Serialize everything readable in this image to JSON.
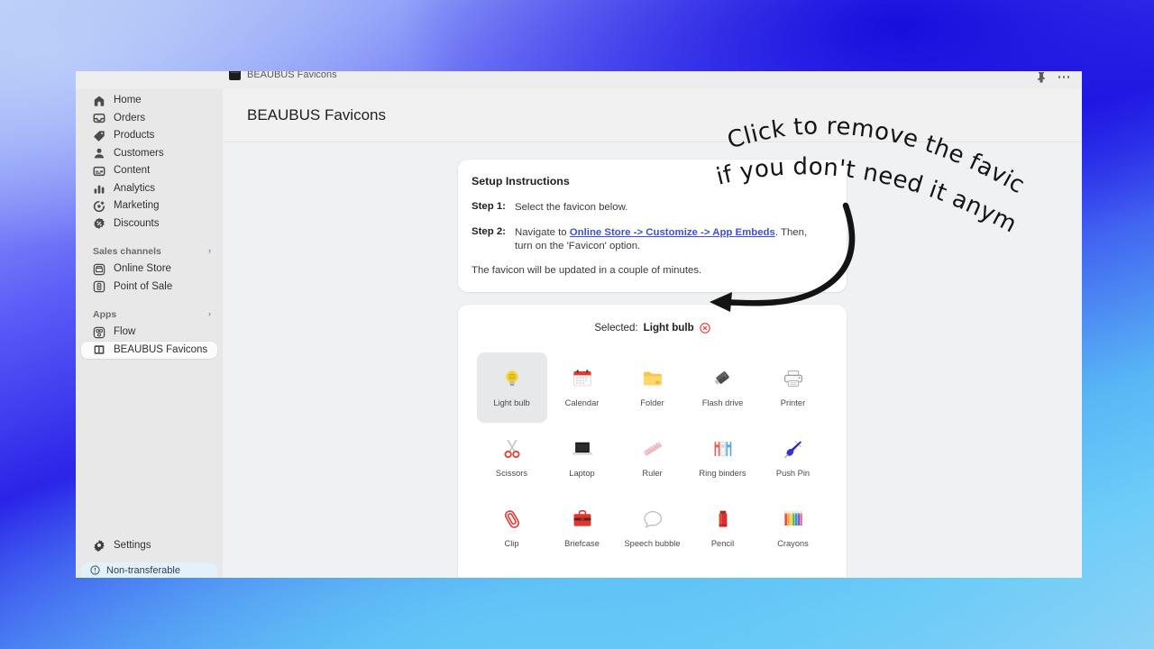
{
  "background": {
    "gradient_from": "#b9cdf5",
    "gradient_mid": "#2a23e8",
    "gradient_to": "#8ed2f6"
  },
  "browser": {
    "tab_title": "BEAUBUS Favicons",
    "tab_favicon_icon": "app-favicon-icon",
    "pin_icon": "pin-icon",
    "more_icon": "more-options-icon"
  },
  "sidebar": {
    "items": [
      {
        "label": "Home",
        "icon": "home-icon"
      },
      {
        "label": "Orders",
        "icon": "orders-icon"
      },
      {
        "label": "Products",
        "icon": "products-icon"
      },
      {
        "label": "Customers",
        "icon": "customers-icon"
      },
      {
        "label": "Content",
        "icon": "content-icon"
      },
      {
        "label": "Analytics",
        "icon": "analytics-icon"
      },
      {
        "label": "Marketing",
        "icon": "marketing-icon"
      },
      {
        "label": "Discounts",
        "icon": "discounts-icon"
      }
    ],
    "sales_channels": {
      "heading": "Sales channels",
      "chevron": "›",
      "items": [
        {
          "label": "Online Store",
          "icon": "online-store-icon"
        },
        {
          "label": "Point of Sale",
          "icon": "point-of-sale-icon"
        }
      ]
    },
    "apps": {
      "heading": "Apps",
      "chevron": "›",
      "items": [
        {
          "label": "Flow",
          "icon": "flow-icon"
        },
        {
          "label": "BEAUBUS Favicons",
          "icon": "beaubus-favicons-icon"
        }
      ],
      "active_label": "BEAUBUS Favicons"
    },
    "settings": {
      "label": "Settings",
      "icon": "gear-icon"
    },
    "banner": {
      "label": "Non-transferable",
      "icon": "info-icon"
    }
  },
  "page": {
    "title": "BEAUBUS Favicons"
  },
  "setup": {
    "title": "Setup Instructions",
    "step1_label": "Step 1:",
    "step1_text": "Select the favicon below.",
    "step2_label": "Step 2:",
    "step2_prefix": "Navigate to ",
    "step2_link": "Online Store -> Customize -> App Embeds",
    "step2_suffix": ". Then, turn on the 'Favicon' option.",
    "note": "The favicon will be updated in a couple of minutes.",
    "link_color": "#3b4fe0"
  },
  "picker": {
    "selected_prefix": "Selected:",
    "selected_name": "Light bulb",
    "remove_icon": "remove-circle-icon",
    "remove_color": "#e8332a",
    "selected_tile_bg": "#e6e8ea",
    "favicons": [
      {
        "label": "Light bulb",
        "icon": "light-bulb-icon",
        "selected": true
      },
      {
        "label": "Calendar",
        "icon": "calendar-icon",
        "selected": false
      },
      {
        "label": "Folder",
        "icon": "folder-icon",
        "selected": false
      },
      {
        "label": "Flash drive",
        "icon": "flash-drive-icon",
        "selected": false
      },
      {
        "label": "Printer",
        "icon": "printer-icon",
        "selected": false
      },
      {
        "label": "Scissors",
        "icon": "scissors-icon",
        "selected": false
      },
      {
        "label": "Laptop",
        "icon": "laptop-icon",
        "selected": false
      },
      {
        "label": "Ruler",
        "icon": "ruler-icon",
        "selected": false
      },
      {
        "label": "Ring binders",
        "icon": "ring-binders-icon",
        "selected": false
      },
      {
        "label": "Push Pin",
        "icon": "push-pin-icon",
        "selected": false
      },
      {
        "label": "Clip",
        "icon": "clip-icon",
        "selected": false
      },
      {
        "label": "Briefcase",
        "icon": "briefcase-icon",
        "selected": false
      },
      {
        "label": "Speech bubble",
        "icon": "speech-bubble-icon",
        "selected": false
      },
      {
        "label": "Pencil",
        "icon": "pencil-icon",
        "selected": false
      },
      {
        "label": "Crayons",
        "icon": "crayons-icon",
        "selected": false
      },
      {
        "label": "",
        "icon": "notepad-icon",
        "selected": false
      },
      {
        "label": "",
        "icon": "palette-icon",
        "selected": false
      },
      {
        "label": "",
        "icon": "notebook-icon",
        "selected": false
      },
      {
        "label": "",
        "icon": "warning-sign-icon",
        "selected": false
      },
      {
        "label": "",
        "icon": "envelope-icon",
        "selected": false
      }
    ]
  },
  "annotation": {
    "line1": "Click to remove the favicon",
    "line2": "if you don't need it anymore",
    "arrow_icon": "curved-arrow-icon",
    "color": "#141414"
  }
}
